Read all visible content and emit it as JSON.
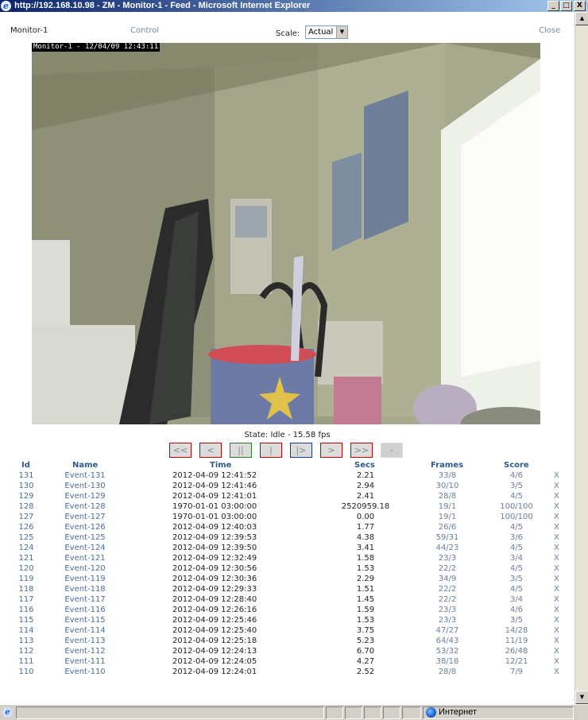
{
  "window": {
    "title": "http://192.168.10.98 - ZM - Monitor-1 - Feed - Microsoft Internet Explorer",
    "minimize": "_",
    "maximize": "□",
    "close": "X"
  },
  "header": {
    "monitor_name": "Monitor-1",
    "control_label": "Control",
    "close_label": "Close",
    "scale_label": "Scale:",
    "scale_value": "Actual"
  },
  "feed": {
    "overlay_text": "Monitor-1 - 12/04/09 12:43:11"
  },
  "status": {
    "state_text": "State: Idle - 15.58 fps"
  },
  "controls": [
    {
      "name": "fast-rewind-button",
      "glyph": "<<"
    },
    {
      "name": "step-back-button",
      "glyph": "<"
    },
    {
      "name": "pause-button",
      "glyph": "||"
    },
    {
      "name": "play-button",
      "glyph": "|"
    },
    {
      "name": "slow-forward-button",
      "glyph": "|>"
    },
    {
      "name": "step-forward-button",
      "glyph": ">"
    },
    {
      "name": "fast-forward-button",
      "glyph": ">>"
    },
    {
      "name": "zoom-out-button",
      "glyph": "-"
    }
  ],
  "events": {
    "headers": {
      "id": "Id",
      "name": "Name",
      "time": "Time",
      "secs": "Secs",
      "frames": "Frames",
      "score": "Score"
    },
    "rows": [
      {
        "id": "131",
        "name": "Event-131",
        "time": "2012-04-09 12:41:52",
        "secs": "2.21",
        "frames": "33/8",
        "score": "4/6",
        "del": "X"
      },
      {
        "id": "130",
        "name": "Event-130",
        "time": "2012-04-09 12:41:46",
        "secs": "2.94",
        "frames": "30/10",
        "score": "3/5",
        "del": "X"
      },
      {
        "id": "129",
        "name": "Event-129",
        "time": "2012-04-09 12:41:01",
        "secs": "2.41",
        "frames": "28/8",
        "score": "4/5",
        "del": "X"
      },
      {
        "id": "128",
        "name": "Event-128",
        "time": "1970-01-01 03:00:00",
        "secs": "2520959.18",
        "frames": "19/1",
        "score": "100/100",
        "del": "X"
      },
      {
        "id": "127",
        "name": "Event-127",
        "time": "1970-01-01 03:00:00",
        "secs": "0.00",
        "frames": "19/1",
        "score": "100/100",
        "del": "X"
      },
      {
        "id": "126",
        "name": "Event-126",
        "time": "2012-04-09 12:40:03",
        "secs": "1.77",
        "frames": "26/6",
        "score": "4/5",
        "del": "X"
      },
      {
        "id": "125",
        "name": "Event-125",
        "time": "2012-04-09 12:39:53",
        "secs": "4.38",
        "frames": "59/31",
        "score": "3/6",
        "del": "X"
      },
      {
        "id": "124",
        "name": "Event-124",
        "time": "2012-04-09 12:39:50",
        "secs": "3.41",
        "frames": "44/23",
        "score": "4/5",
        "del": "X"
      },
      {
        "id": "121",
        "name": "Event-121",
        "time": "2012-04-09 12:32:49",
        "secs": "1.58",
        "frames": "23/3",
        "score": "3/4",
        "del": "X"
      },
      {
        "id": "120",
        "name": "Event-120",
        "time": "2012-04-09 12:30:56",
        "secs": "1.53",
        "frames": "22/2",
        "score": "4/5",
        "del": "X"
      },
      {
        "id": "119",
        "name": "Event-119",
        "time": "2012-04-09 12:30:36",
        "secs": "2.29",
        "frames": "34/9",
        "score": "3/5",
        "del": "X"
      },
      {
        "id": "118",
        "name": "Event-118",
        "time": "2012-04-09 12:29:33",
        "secs": "1.51",
        "frames": "22/2",
        "score": "4/5",
        "del": "X"
      },
      {
        "id": "117",
        "name": "Event-117",
        "time": "2012-04-09 12:28:40",
        "secs": "1.45",
        "frames": "22/2",
        "score": "3/4",
        "del": "X"
      },
      {
        "id": "116",
        "name": "Event-116",
        "time": "2012-04-09 12:26:16",
        "secs": "1.59",
        "frames": "23/3",
        "score": "4/6",
        "del": "X"
      },
      {
        "id": "115",
        "name": "Event-115",
        "time": "2012-04-09 12:25:46",
        "secs": "1.53",
        "frames": "23/3",
        "score": "3/5",
        "del": "X"
      },
      {
        "id": "114",
        "name": "Event-114",
        "time": "2012-04-09 12:25:40",
        "secs": "3.75",
        "frames": "47/27",
        "score": "14/28",
        "del": "X"
      },
      {
        "id": "113",
        "name": "Event-113",
        "time": "2012-04-09 12:25:18",
        "secs": "5.23",
        "frames": "64/43",
        "score": "11/19",
        "del": "X"
      },
      {
        "id": "112",
        "name": "Event-112",
        "time": "2012-04-09 12:24:13",
        "secs": "6.70",
        "frames": "53/32",
        "score": "26/48",
        "del": "X"
      },
      {
        "id": "111",
        "name": "Event-111",
        "time": "2012-04-09 12:24:05",
        "secs": "4.27",
        "frames": "38/18",
        "score": "12/21",
        "del": "X"
      },
      {
        "id": "110",
        "name": "Event-110",
        "time": "2012-04-09 12:24:01",
        "secs": "2.52",
        "frames": "28/8",
        "score": "7/9",
        "del": "X"
      }
    ]
  },
  "statusbar": {
    "zone_text": "Интернет"
  }
}
